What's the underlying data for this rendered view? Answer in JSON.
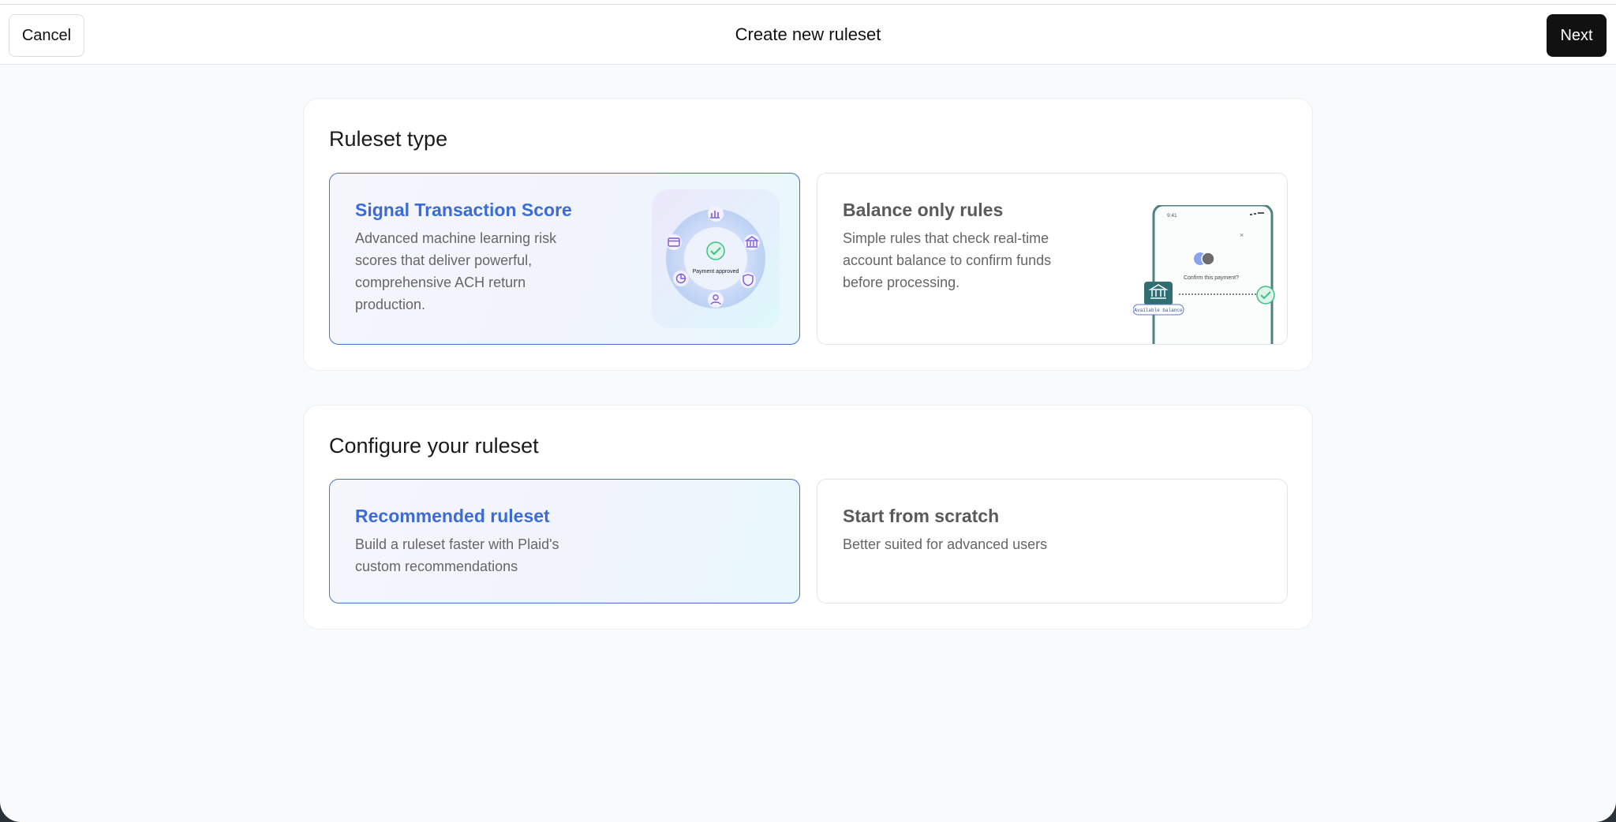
{
  "header": {
    "cancel_label": "Cancel",
    "title": "Create new ruleset",
    "next_label": "Next"
  },
  "ruleset_type": {
    "heading": "Ruleset type",
    "options": [
      {
        "title": "Signal Transaction Score",
        "description_lines": [
          "Advanced machine learning risk",
          "scores that deliver powerful,",
          "comprehensive ACH return",
          "production."
        ],
        "selected": true,
        "illustration": {
          "center_label": "Payment approved",
          "icons": [
            "bar-chart-icon",
            "bank-icon",
            "shield-icon",
            "user-icon",
            "pie-chart-icon",
            "card-icon",
            "check-icon"
          ]
        }
      },
      {
        "title": "Balance only rules",
        "description_lines": [
          "Simple rules that check real-time",
          "account balance to confirm funds",
          "before processing."
        ],
        "selected": false,
        "illustration": {
          "time": "9:41",
          "prompt": "Confirm this payment?",
          "badge": "Available balance",
          "close_glyph": "×",
          "icons": [
            "bank-icon",
            "check-icon",
            "close-icon"
          ]
        }
      }
    ]
  },
  "configure": {
    "heading": "Configure your ruleset",
    "options": [
      {
        "title": "Recommended ruleset",
        "description_lines": [
          "Build a ruleset faster with Plaid's",
          "custom recommendations"
        ],
        "selected": true
      },
      {
        "title": "Start from scratch",
        "description_lines": [
          "Better suited for advanced users"
        ],
        "selected": false
      }
    ]
  },
  "colors": {
    "accent_blue": "#3b6bd8",
    "selected_border": "#4a6fd8",
    "next_button": "#111111",
    "check_green": "#3fbf86",
    "icon_purple": "#7a5bd6",
    "phone_teal": "#2f6f73"
  }
}
